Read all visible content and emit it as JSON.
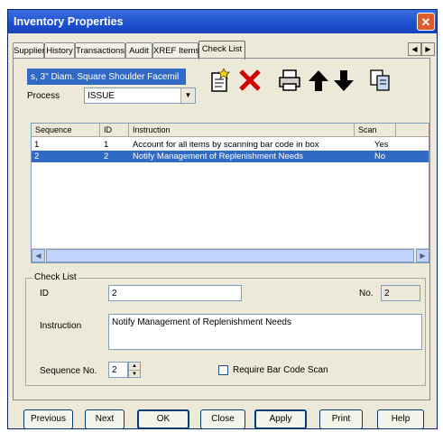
{
  "window": {
    "title": "Inventory Properties",
    "close_glyph": "✕"
  },
  "tabs": [
    {
      "label": "Suppliers"
    },
    {
      "label": "History"
    },
    {
      "label": "Transactions"
    },
    {
      "label": "Audit"
    },
    {
      "label": "XREF Items"
    },
    {
      "label": "Check List",
      "active": true
    }
  ],
  "tab_scroll": {
    "left": "◀",
    "right": "▶"
  },
  "item": {
    "selected_item": "s, 3\" Diam. Square Shoulder Facemil"
  },
  "process": {
    "label": "Process",
    "value": "ISSUE"
  },
  "toolbar": [
    "new-icon",
    "delete-icon",
    "print-icon",
    "move-up-icon",
    "move-down-icon",
    "copy-icon"
  ],
  "grid": {
    "columns": [
      "Sequence",
      "ID",
      "Instruction",
      "Scan"
    ],
    "rows": [
      {
        "sequence": "1",
        "id": "1",
        "instruction": "Account for all items by scanning bar code in box",
        "scan": "Yes",
        "selected": false
      },
      {
        "sequence": "2",
        "id": "2",
        "instruction": "Notify Management of Replenishment Needs",
        "scan": "No",
        "selected": true
      }
    ]
  },
  "checklist": {
    "group_label": "Check List",
    "id_label": "ID",
    "id_value": "2",
    "no_label": "No.",
    "no_value": "2",
    "instruction_label": "Instruction",
    "instruction_value": "Notify Management of Replenishment Needs",
    "sequence_label": "Sequence No.",
    "sequence_value": "2",
    "require_scan_label": "Require Bar Code Scan"
  },
  "buttons": {
    "previous": "Previous",
    "next": "Next",
    "ok": "OK",
    "close": "Close",
    "apply": "Apply",
    "print": "Print",
    "help": "Help"
  },
  "colors": {
    "title_bar": "#1c4fd0",
    "selection": "#316ac5",
    "dialog_bg": "#ece9d8"
  }
}
